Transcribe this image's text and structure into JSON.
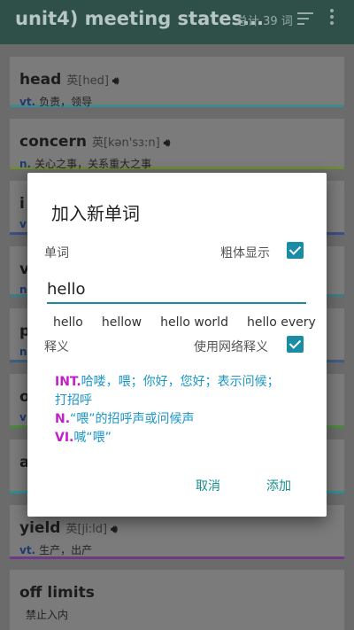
{
  "appbar": {
    "title": "unit4) meeting states...",
    "count": "总计 39 词",
    "sort_icon": "sort-icon",
    "more_icon": "more-vert-icon"
  },
  "cards": [
    {
      "word": "head",
      "phonetic": "英[hed]",
      "pos": "vt.",
      "def": "负责，领导"
    },
    {
      "word": "concern",
      "phonetic": "英[kən'sɜ:n]",
      "pos": "n.",
      "def": "关心之事，关系重大之事"
    },
    {
      "word": "i",
      "phonetic": "",
      "pos": "v",
      "def": ""
    },
    {
      "word": "v",
      "phonetic": "",
      "pos": "n",
      "def": ""
    },
    {
      "word": "p",
      "phonetic": "",
      "pos": "n",
      "def": ""
    },
    {
      "word": "o",
      "phonetic": "",
      "pos": "v",
      "def": ""
    },
    {
      "word": "a",
      "phonetic": "",
      "pos": "",
      "def": ""
    },
    {
      "word": "yield",
      "phonetic": "英[ji:ld]",
      "pos": "vt.",
      "def": "生产，出产"
    },
    {
      "word": "off limits",
      "phonetic": "",
      "pos": "",
      "def": "禁止入内"
    }
  ],
  "dialog": {
    "title": "加入新单词",
    "word_label": "单词",
    "bold_label": "粗体显示",
    "word_value": "hello",
    "suggestions": [
      "hello",
      "hellow",
      "hello world",
      "hello every"
    ],
    "meaning_label": "释义",
    "web_label": "使用网络释义",
    "definitions": [
      {
        "pos": "INT.",
        "text": "哈喽，喂；你好，您好；表示问候；打招呼"
      },
      {
        "pos": "N.",
        "text": "“喂”的招呼声或问候声"
      },
      {
        "pos": "VI.",
        "text": "喊“喂”"
      }
    ],
    "cancel": "取消",
    "add": "添加"
  },
  "colors": {
    "accent": "#1b8ca6",
    "pos_highlight": "#c21ec9",
    "definition": "#1b96c8",
    "appbar": "#2f4f49"
  }
}
